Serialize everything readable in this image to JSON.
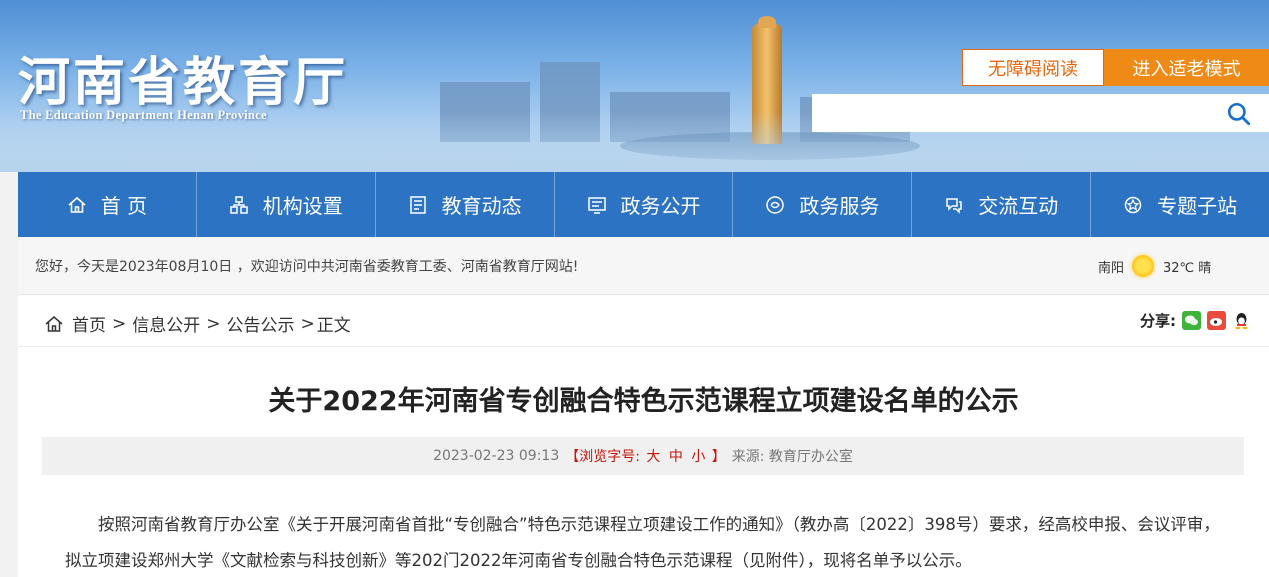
{
  "header": {
    "logo_cn": "河南省教育厅",
    "logo_en": "The Education Department Henan Province",
    "accessibility_label": "无障碍阅读",
    "elder_mode_label": "进入适老模式",
    "search_placeholder": ""
  },
  "nav": {
    "items": [
      {
        "label": "首 页",
        "icon": "home-icon"
      },
      {
        "label": "机构设置",
        "icon": "org-icon"
      },
      {
        "label": "教育动态",
        "icon": "news-icon"
      },
      {
        "label": "政务公开",
        "icon": "gov-info-icon"
      },
      {
        "label": "政务服务",
        "icon": "service-icon"
      },
      {
        "label": "交流互动",
        "icon": "interaction-icon"
      },
      {
        "label": "专题子站",
        "icon": "subsite-icon"
      }
    ]
  },
  "welcome": {
    "text": "您好，今天是2023年08月10日 ，欢迎访问中共河南省委教育工委、河南省教育厅网站!",
    "city": "南阳",
    "weather": "32℃ 晴"
  },
  "breadcrumb": {
    "items": [
      "首页",
      "信息公开",
      "公告公示"
    ],
    "current": "正文",
    "sep": ">",
    "share_label": "分享:"
  },
  "article": {
    "title": "关于2022年河南省专创融合特色示范课程立项建设名单的公示",
    "date": "2023-02-23 09:13",
    "fontsize_label": "【浏览字号:",
    "fontsize_large": "大",
    "fontsize_medium": "中",
    "fontsize_small": "小",
    "fontsize_close": "】",
    "source": "来源: 教育厅办公室",
    "paragraph": "按照河南省教育厅办公室《关于开展河南省首批“专创融合”特色示范课程立项建设工作的通知》（教办高〔2022〕398号）要求，经高校申报、会议评审，拟立项建设郑州大学《文献检索与科技创新》等202门2022年河南省专创融合特色示范课程（见附件），现将名单予以公示。"
  },
  "colors": {
    "nav_bg": "#2c73c3",
    "accent_orange": "#f08a16",
    "font_size_red": "#c4150c"
  }
}
